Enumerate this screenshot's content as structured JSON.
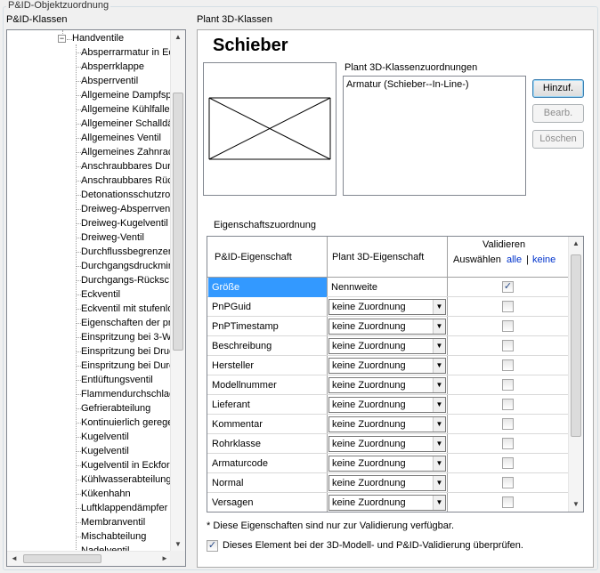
{
  "group": {
    "title": "P&ID-Objektzuordnung"
  },
  "left": {
    "header": "P&ID-Klassen",
    "parent_node": "Handventile",
    "items": [
      "Absperrarmatur in Ec",
      "Absperrklappe",
      "Absperrventil",
      "Allgemeine Dampfspe",
      "Allgemeine Kühlfalle",
      "Allgemeiner Schalldä",
      "Allgemeines Ventil",
      "Allgemeines Zahnrad",
      "Anschraubbares Dur",
      "Anschraubbares Rüc",
      "Detonationsschutzrol",
      "Dreiweg-Absperrvent",
      "Dreiweg-Kugelventil",
      "Dreiweg-Ventil",
      "Durchflussbegrenzer",
      "Durchgangsdruckmir",
      "Durchgangs-Rücksc",
      "Eckventil",
      "Eckventil mit stufenlo",
      "Eigenschaften der pr",
      "Einspritzung bei 3-We",
      "Einspritzung bei Druc",
      "Einspritzung bei Durc",
      "Entlüftungsventil",
      "Flammendurchschlag",
      "Gefrierabteilung",
      "Kontinuierlich gerege",
      "Kugelventil",
      "Kugelventil",
      "Kugelventil in Eckfor",
      "Kühlwasserabteilung",
      "Kükenhahn",
      "Luftklappendämpfer",
      "Membranventil",
      "Mischabteilung",
      "Nadelventil"
    ]
  },
  "right": {
    "header": "Plant 3D-Klassen",
    "title": "Schieber",
    "mapping_label": "Plant 3D-Klassenzuordnungen",
    "mapping_items": [
      "Armatur (Schieber--In-Line-)"
    ],
    "buttons": {
      "add": "Hinzuf.",
      "edit": "Bearb.",
      "delete": "Löschen"
    },
    "props_label": "Eigenschaftszuordnung",
    "grid": {
      "col1": "P&ID-Eigenschaft",
      "col2": "Plant 3D-Eigenschaft",
      "col3_title": "Validieren",
      "col3_select": "Auswählen",
      "col3_all": "alle",
      "col3_sep": "|",
      "col3_none": "keine",
      "rows": [
        {
          "name": "Größe",
          "value": "Nennweite",
          "checked": true,
          "selected": true,
          "combo": false
        },
        {
          "name": "PnPGuid",
          "value": "keine Zuordnung",
          "checked": false,
          "selected": false,
          "combo": true
        },
        {
          "name": "PnPTimestamp",
          "value": "keine Zuordnung",
          "checked": false,
          "selected": false,
          "combo": true
        },
        {
          "name": "Beschreibung",
          "value": "keine Zuordnung",
          "checked": false,
          "selected": false,
          "combo": true
        },
        {
          "name": "Hersteller",
          "value": "keine Zuordnung",
          "checked": false,
          "selected": false,
          "combo": true
        },
        {
          "name": "Modellnummer",
          "value": "keine Zuordnung",
          "checked": false,
          "selected": false,
          "combo": true
        },
        {
          "name": "Lieferant",
          "value": "keine Zuordnung",
          "checked": false,
          "selected": false,
          "combo": true
        },
        {
          "name": "Kommentar",
          "value": "keine Zuordnung",
          "checked": false,
          "selected": false,
          "combo": true
        },
        {
          "name": "Rohrklasse",
          "value": "keine Zuordnung",
          "checked": false,
          "selected": false,
          "combo": true
        },
        {
          "name": "Armaturcode",
          "value": "keine Zuordnung",
          "checked": false,
          "selected": false,
          "combo": true
        },
        {
          "name": "Normal",
          "value": "keine Zuordnung",
          "checked": false,
          "selected": false,
          "combo": true
        },
        {
          "name": "Versagen",
          "value": "keine Zuordnung",
          "checked": false,
          "selected": false,
          "combo": true
        }
      ]
    },
    "footnote": "* Diese Eigenschaften sind nur zur Validierung verfügbar.",
    "validate_checkbox": {
      "label": "Dieses Element bei der 3D-Modell- und P&ID-Validierung überprüfen.",
      "checked": true
    }
  }
}
